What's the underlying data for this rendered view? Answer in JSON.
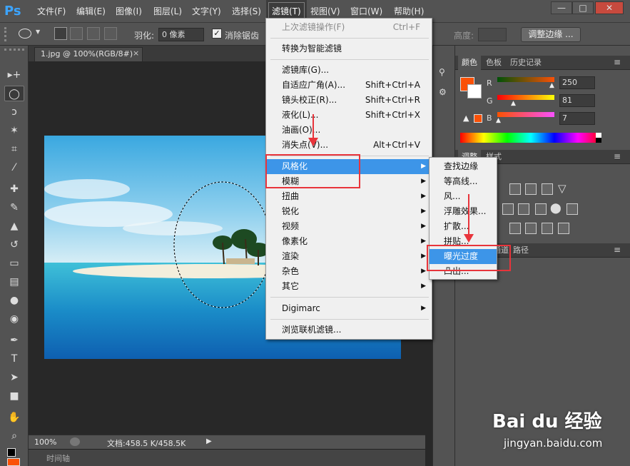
{
  "app": {
    "logo": "Ps"
  },
  "menubar": {
    "items": [
      "文件(F)",
      "编辑(E)",
      "图像(I)",
      "图层(L)",
      "文字(Y)",
      "选择(S)",
      "滤镜(T)",
      "视图(V)",
      "窗口(W)",
      "帮助(H)"
    ],
    "active_index": 6
  },
  "window_controls": {
    "minimize": "—",
    "restore": "□",
    "close": "✕"
  },
  "options": {
    "feather_label": "羽化:",
    "feather_value": "0 像素",
    "antialias_label": "消除锯齿",
    "antialias_checked": true,
    "height_label": "高度:",
    "refine_edge": "调整边缘 ..."
  },
  "document": {
    "tab_title": "1.jpg @ 100%(RGB/8#)",
    "tab_close": "×",
    "zoom": "100%",
    "doc_info": "文档:458.5 K/458.5K",
    "timeline_label": "时间轴"
  },
  "filter_menu": {
    "items": [
      {
        "label": "上次滤镜操作(F)",
        "shortcut": "Ctrl+F",
        "disabled": true
      },
      {
        "label": "转换为智能滤镜"
      },
      {
        "label": "滤镜库(G)..."
      },
      {
        "label": "自适应广角(A)...",
        "shortcut": "Shift+Ctrl+A"
      },
      {
        "label": "镜头校正(R)...",
        "shortcut": "Shift+Ctrl+R"
      },
      {
        "label": "液化(L)...",
        "shortcut": "Shift+Ctrl+X"
      },
      {
        "label": "油画(O)..."
      },
      {
        "label": "消失点(V)...",
        "shortcut": "Alt+Ctrl+V"
      },
      {
        "label": "风格化",
        "submenu": true,
        "highlight": true
      },
      {
        "label": "模糊",
        "submenu": true
      },
      {
        "label": "扭曲",
        "submenu": true
      },
      {
        "label": "锐化",
        "submenu": true
      },
      {
        "label": "视频",
        "submenu": true
      },
      {
        "label": "像素化",
        "submenu": true
      },
      {
        "label": "渲染",
        "submenu": true
      },
      {
        "label": "杂色",
        "submenu": true
      },
      {
        "label": "其它",
        "submenu": true
      },
      {
        "label": "Digimarc",
        "submenu": true
      },
      {
        "label": "浏览联机滤镜..."
      }
    ]
  },
  "stylize_submenu": {
    "items": [
      "查找边缘",
      "等高线...",
      "风...",
      "浮雕效果...",
      "扩散...",
      "拼贴...",
      "曝光过度",
      "凸出..."
    ],
    "highlight_index": 6
  },
  "color_panel": {
    "tabs": [
      "颜色",
      "色板",
      "历史记录"
    ],
    "r_label": "R",
    "g_label": "G",
    "b_label": "B",
    "r": "250",
    "g": "81",
    "b": "7",
    "foreground": "#fa5107",
    "background": "#ffffff"
  },
  "adjust_panel": {
    "tabs": [
      "调整",
      "样式"
    ]
  },
  "layers_panel": {
    "tabs": [
      "通道",
      "路径"
    ]
  },
  "watermark": {
    "brand": "Bai du 经验",
    "url": "jingyan.baidu.com"
  }
}
